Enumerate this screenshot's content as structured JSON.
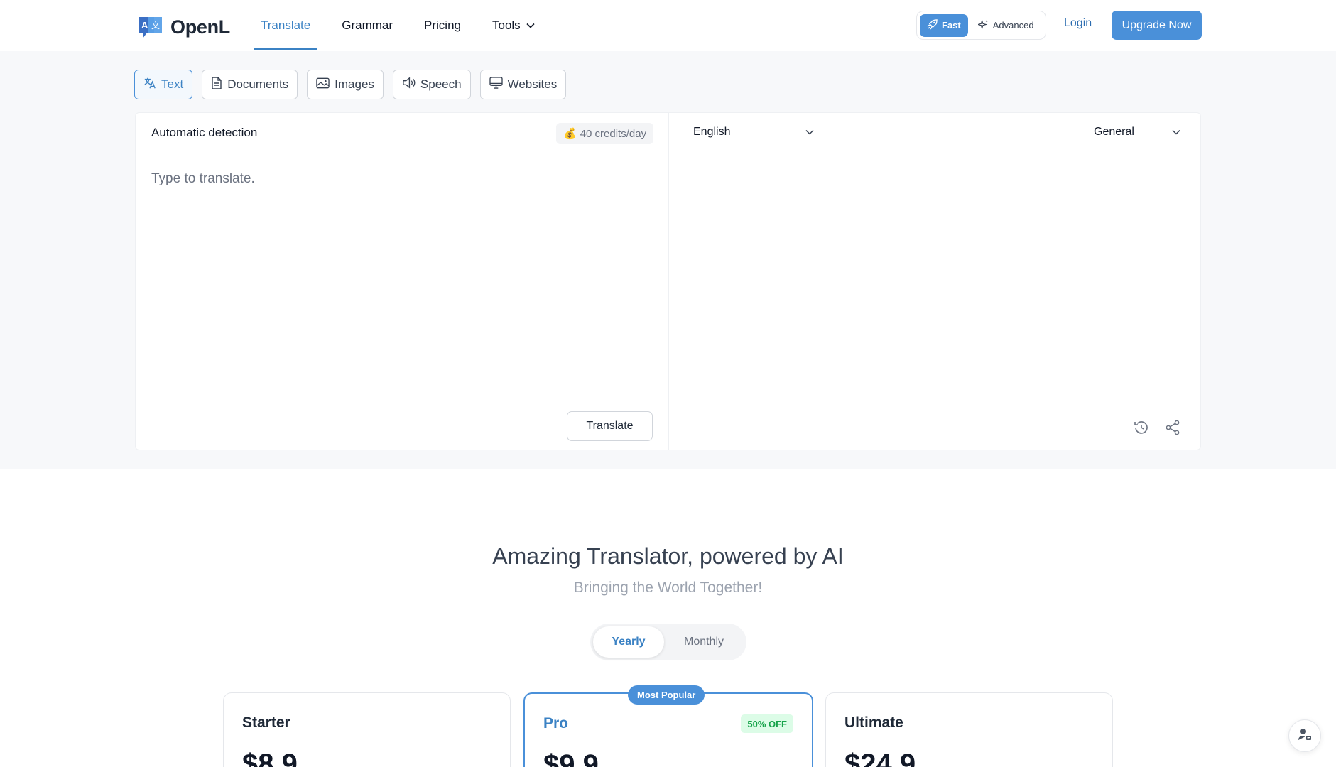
{
  "brand": {
    "name": "OpenL",
    "logo_icon": "translate-logo-icon"
  },
  "nav": {
    "items": [
      {
        "label": "Translate",
        "active": true
      },
      {
        "label": "Grammar"
      },
      {
        "label": "Pricing"
      },
      {
        "label": "Tools",
        "has_dropdown": true
      }
    ]
  },
  "mode": {
    "fast": "Fast",
    "advanced": "Advanced",
    "selected": "Fast"
  },
  "account": {
    "login": "Login",
    "upgrade": "Upgrade Now"
  },
  "tabs": [
    {
      "label": "Text",
      "icon": "translate-icon",
      "active": true
    },
    {
      "label": "Documents",
      "icon": "document-icon"
    },
    {
      "label": "Images",
      "icon": "image-icon"
    },
    {
      "label": "Speech",
      "icon": "speaker-icon"
    },
    {
      "label": "Websites",
      "icon": "monitor-icon"
    }
  ],
  "source": {
    "language": "Automatic detection",
    "credits": "40 credits/day",
    "credits_icon": "money-bag-icon",
    "placeholder": "Type to translate.",
    "value": "",
    "translate_button": "Translate"
  },
  "target": {
    "language": "English",
    "style": "General",
    "actions": [
      "history-icon",
      "share-icon"
    ]
  },
  "hero": {
    "title": "Amazing Translator, powered by AI",
    "subtitle": "Bringing the World Together!"
  },
  "billing": {
    "yearly": "Yearly",
    "monthly": "Monthly",
    "selected": "Yearly"
  },
  "plans": [
    {
      "name": "Starter",
      "price": "$8.9"
    },
    {
      "name": "Pro",
      "price": "$9.9",
      "badge": "Most Popular",
      "discount": "50% OFF"
    },
    {
      "name": "Ultimate",
      "price": "$24.9"
    }
  ],
  "colors": {
    "accent": "#4a90d9",
    "accent_text": "#3b82c4",
    "discount_bg": "#dcfce7",
    "discount_text": "#16a34a"
  }
}
